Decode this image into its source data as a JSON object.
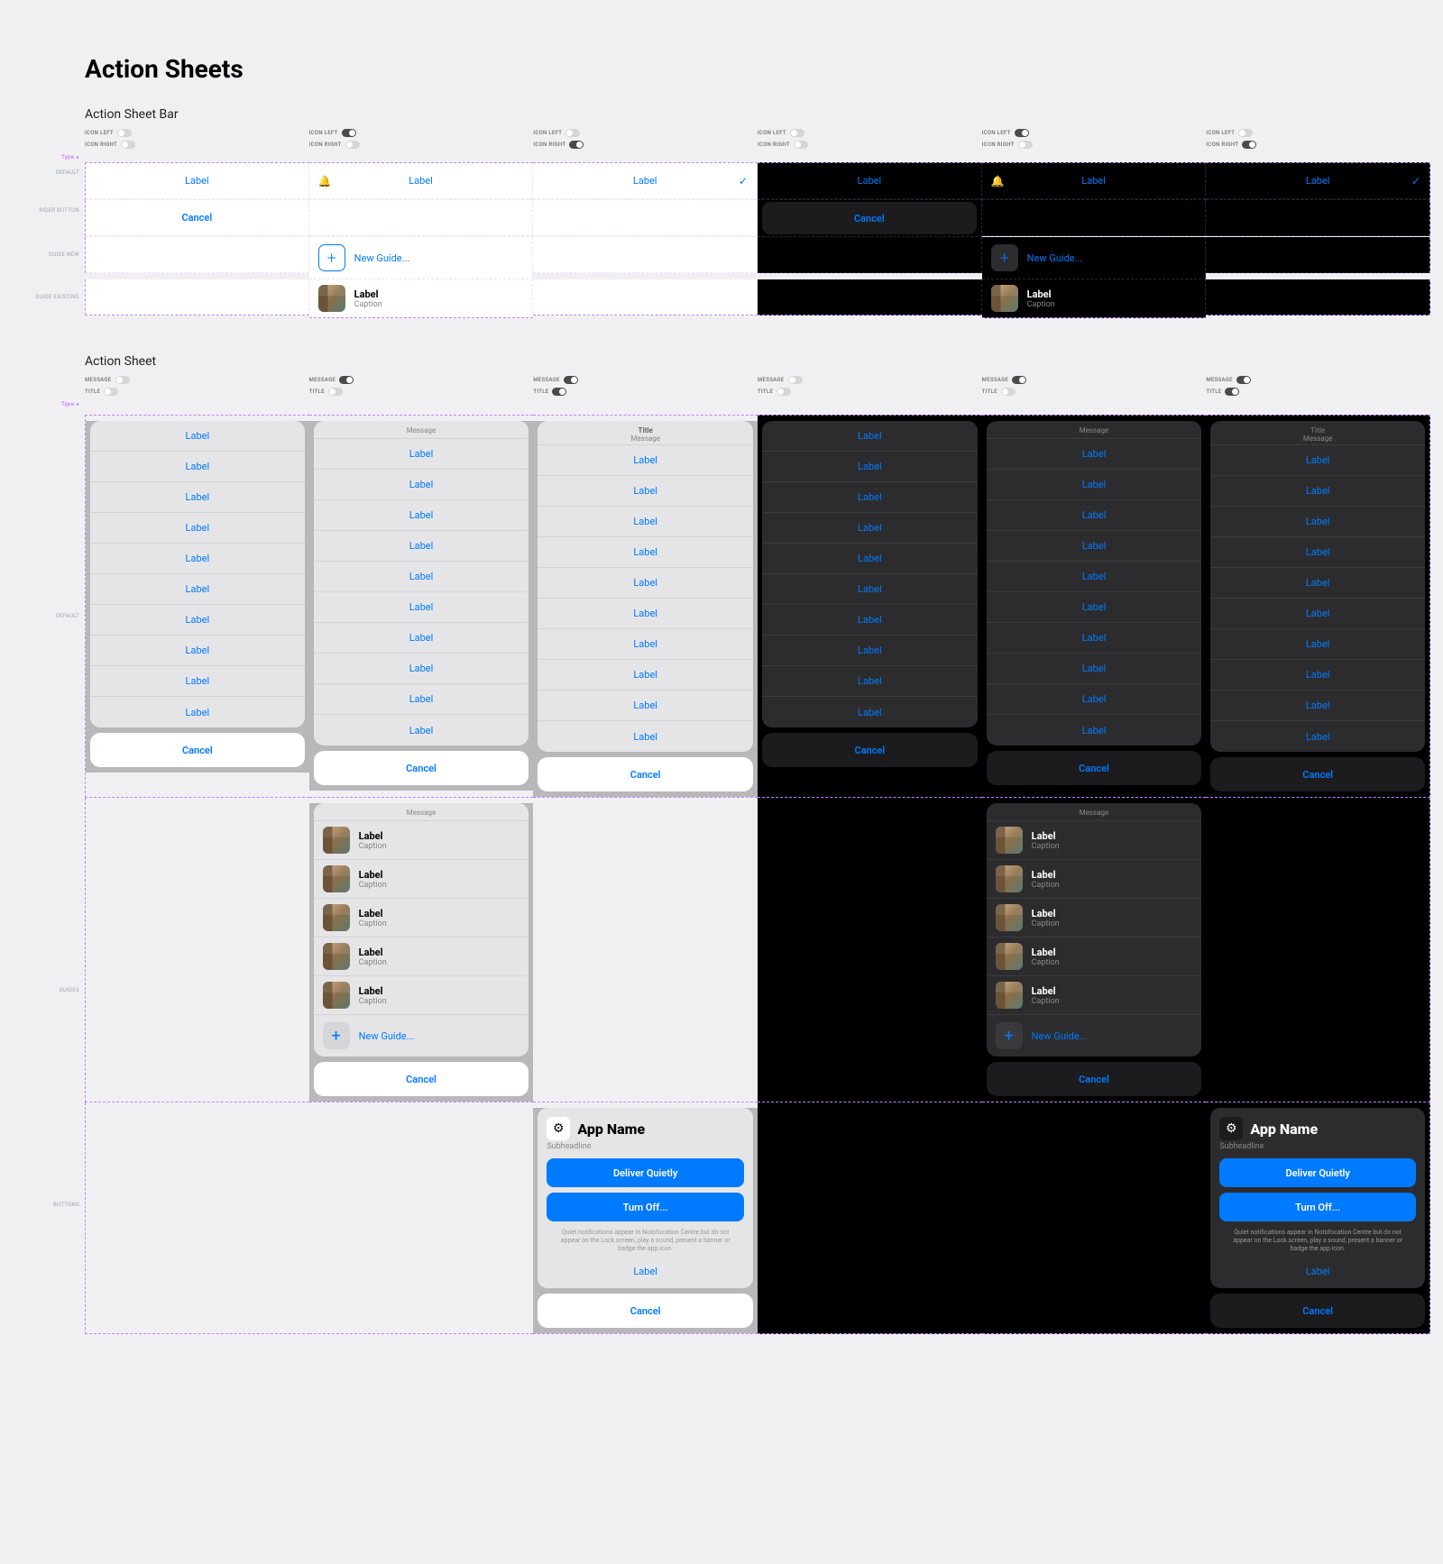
{
  "title": "Action Sheets",
  "section1": "Action Sheet Bar",
  "section2": "Action Sheet",
  "toggles": {
    "iconLeft": "ICON LEFT",
    "iconRight": "ICON RIGHT",
    "message": "MESSAGE",
    "titleT": "TITLE"
  },
  "typeLabel": "Type ◂",
  "rowlabels": {
    "default": "DEFAULT",
    "riderButton": "RIDER BUTTON",
    "guideNew": "GUIDE NEW",
    "guideExisting": "GUIDE EXISTING",
    "guides": "GUIDES",
    "buttons": "BUTTONS"
  },
  "common": {
    "label": "Label",
    "cancel": "Cancel",
    "caption": "Caption",
    "newGuide": "New Guide...",
    "message": "Message",
    "titleWord": "Title"
  },
  "appCard": {
    "appName": "App Name",
    "sub": "Subheadline",
    "deliver": "Deliver Quietly",
    "turnOff": "Turn Off...",
    "fine": "Quiet notifications appear in Notofocation Centre but do not appear on the Lock screen, play a sound, present a banner or badge the app icon."
  },
  "icons": {
    "bell": "🔔",
    "check": "✓",
    "plus": "+",
    "gear": "⚙"
  }
}
